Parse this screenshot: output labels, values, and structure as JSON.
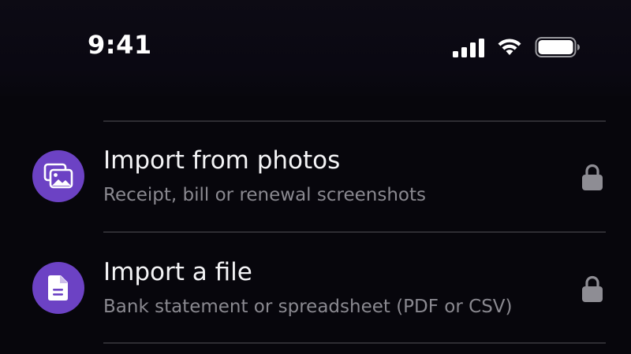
{
  "status_bar": {
    "time": "9:41",
    "signal_icon": "cellular-signal-icon",
    "wifi_icon": "wifi-icon",
    "battery_icon": "battery-icon"
  },
  "import_options": [
    {
      "title": "Import from photos",
      "subtitle": "Receipt, bill or renewal screenshots",
      "icon": "photos-icon",
      "locked": true,
      "lock_icon": "lock-icon"
    },
    {
      "title": "Import a file",
      "subtitle": "Bank statement or spreadsheet (PDF or CSV)",
      "icon": "document-icon",
      "locked": true,
      "lock_icon": "lock-icon"
    }
  ],
  "colors": {
    "background": "#07060c",
    "accent": "#6c42c4",
    "primary_text": "#f4f4f6",
    "secondary_text": "#8a8990",
    "divider": "#2e2d33",
    "lock": "#8e8d94"
  }
}
